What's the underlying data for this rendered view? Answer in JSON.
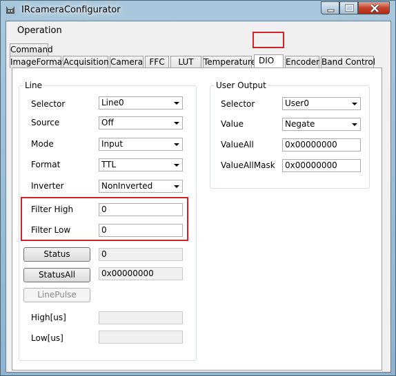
{
  "window": {
    "title": "IRcameraConfigurator",
    "icon": "cat-app-icon"
  },
  "menu": {
    "operation": "Operation"
  },
  "tabs_row1": [
    {
      "label": "Command"
    }
  ],
  "tabs_row2": [
    {
      "label": "ImageFormat"
    },
    {
      "label": "Acquisition"
    },
    {
      "label": "Camera"
    },
    {
      "label": "FFC"
    },
    {
      "label": "LUT"
    },
    {
      "label": "Temperature"
    },
    {
      "label": "DIO"
    },
    {
      "label": "Encoder"
    },
    {
      "label": "Band Control"
    }
  ],
  "active_tab": "DIO",
  "line": {
    "title": "Line",
    "selector": {
      "label": "Selector",
      "value": "Line0"
    },
    "source": {
      "label": "Source",
      "value": "Off"
    },
    "mode": {
      "label": "Mode",
      "value": "Input"
    },
    "format": {
      "label": "Format",
      "value": "TTL"
    },
    "inverter": {
      "label": "Inverter",
      "value": "NonInverted"
    },
    "filter_high": {
      "label": "Filter High",
      "value": "0"
    },
    "filter_low": {
      "label": "Filter Low",
      "value": "0"
    },
    "status": {
      "button": "Status",
      "value": "0"
    },
    "status_all": {
      "button": "StatusAll",
      "value": "0x00000000"
    },
    "line_pulse": {
      "button": "LinePulse"
    },
    "high_us": {
      "label": "High[us]",
      "value": ""
    },
    "low_us": {
      "label": "Low[us]",
      "value": ""
    }
  },
  "user_output": {
    "title": "User Output",
    "selector": {
      "label": "Selector",
      "value": "User0"
    },
    "value": {
      "label": "Value",
      "value": "Negate"
    },
    "value_all": {
      "label": "ValueAll",
      "value": "0x00000000"
    },
    "value_all_mask": {
      "label": "ValueAllMask",
      "value": "0x00000000"
    }
  },
  "colors": {
    "highlight": "#d0202a",
    "title_bar": "#a9c7dc",
    "close_button": "#c7432b"
  }
}
